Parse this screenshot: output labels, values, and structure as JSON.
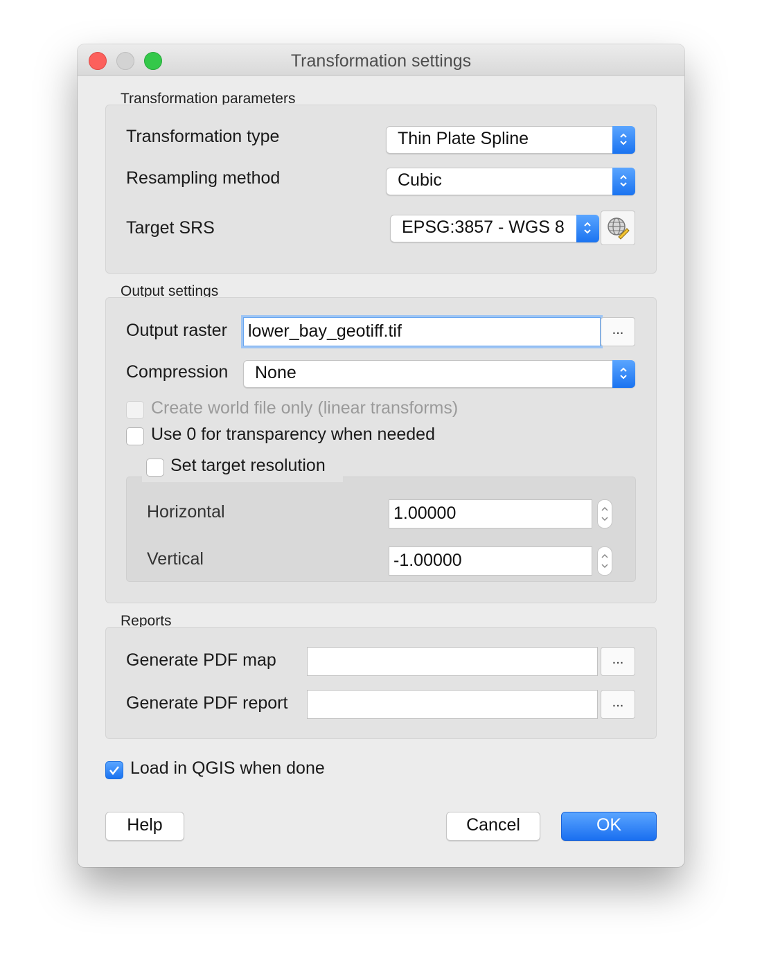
{
  "window": {
    "title": "Transformation settings"
  },
  "transformation": {
    "group_title": "Transformation parameters",
    "type_label": "Transformation type",
    "type_value": "Thin Plate Spline",
    "resampling_label": "Resampling method",
    "resampling_value": "Cubic",
    "srs_label": "Target SRS",
    "srs_value": "EPSG:3857 - WGS 8"
  },
  "output": {
    "group_title": "Output settings",
    "raster_label": "Output raster",
    "raster_value": "lower_bay_geotiff.tif",
    "browse_label": "...",
    "compression_label": "Compression",
    "compression_value": "None",
    "world_file_label": "Create world file only (linear transforms)",
    "world_file_checked": false,
    "transparency_label": "Use 0 for transparency when needed",
    "transparency_checked": false,
    "target_res_label": "Set target resolution",
    "target_res_checked": false,
    "horizontal_label": "Horizontal",
    "horizontal_value": "1.00000",
    "vertical_label": "Vertical",
    "vertical_value": "-1.00000"
  },
  "reports": {
    "group_title": "Reports",
    "pdf_map_label": "Generate PDF map",
    "pdf_map_value": "",
    "pdf_report_label": "Generate PDF report",
    "pdf_report_value": "",
    "browse_label": "..."
  },
  "load_in_qgis": {
    "label": "Load in QGIS when done",
    "checked": true
  },
  "buttons": {
    "help": "Help",
    "cancel": "Cancel",
    "ok": "OK"
  },
  "colors": {
    "accent": "#1a73f0",
    "window_bg": "#ececec",
    "group_bg": "#e3e3e3"
  },
  "icons": {
    "srs_selector": "globe-pencil-icon",
    "combo_arrows": "updown-chevron-icon",
    "checkmark": "checkmark-icon"
  }
}
